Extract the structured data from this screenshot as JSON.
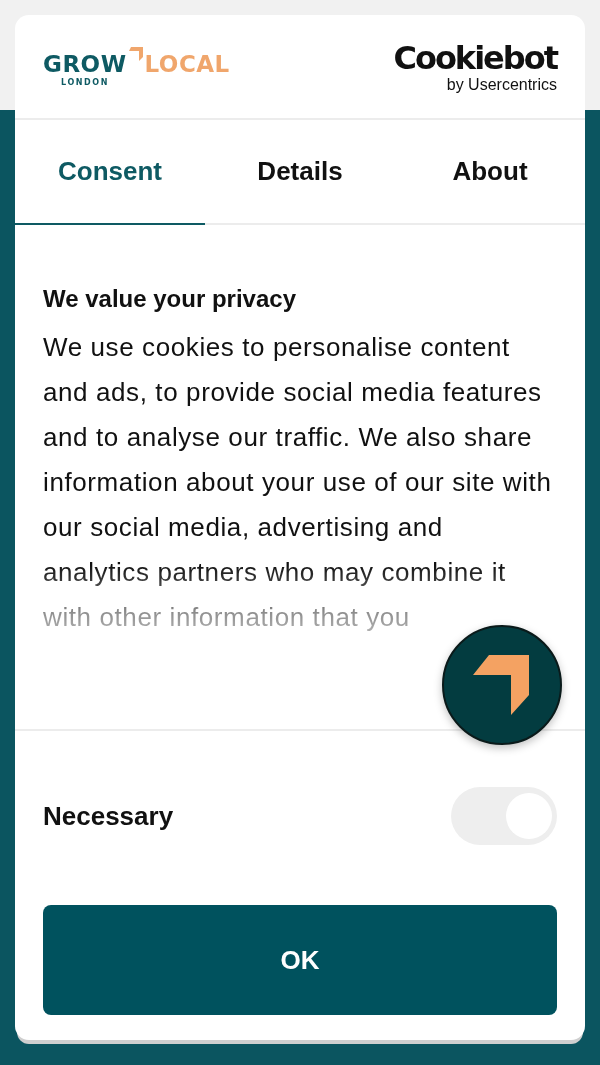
{
  "brand_logo": {
    "word_1": "GROW",
    "word_2": "LOCAL",
    "subtitle": "LONDON"
  },
  "provider_logo": {
    "name": "Cookiebot",
    "byline": "by Usercentrics"
  },
  "tabs": [
    {
      "label": "Consent",
      "selected": true
    },
    {
      "label": "Details",
      "selected": false
    },
    {
      "label": "About",
      "selected": false
    }
  ],
  "consent": {
    "heading": "We value your privacy",
    "body": "We use cookies to personalise content and ads, to provide social media features and to analyse our traffic. We also share information about your use of our site with our social media, advertising and analytics partners who may combine it with other information that you"
  },
  "categories": [
    {
      "label": "Necessary",
      "on": true,
      "disabled": true
    }
  ],
  "buttons": [
    {
      "label": "OK"
    }
  ]
}
